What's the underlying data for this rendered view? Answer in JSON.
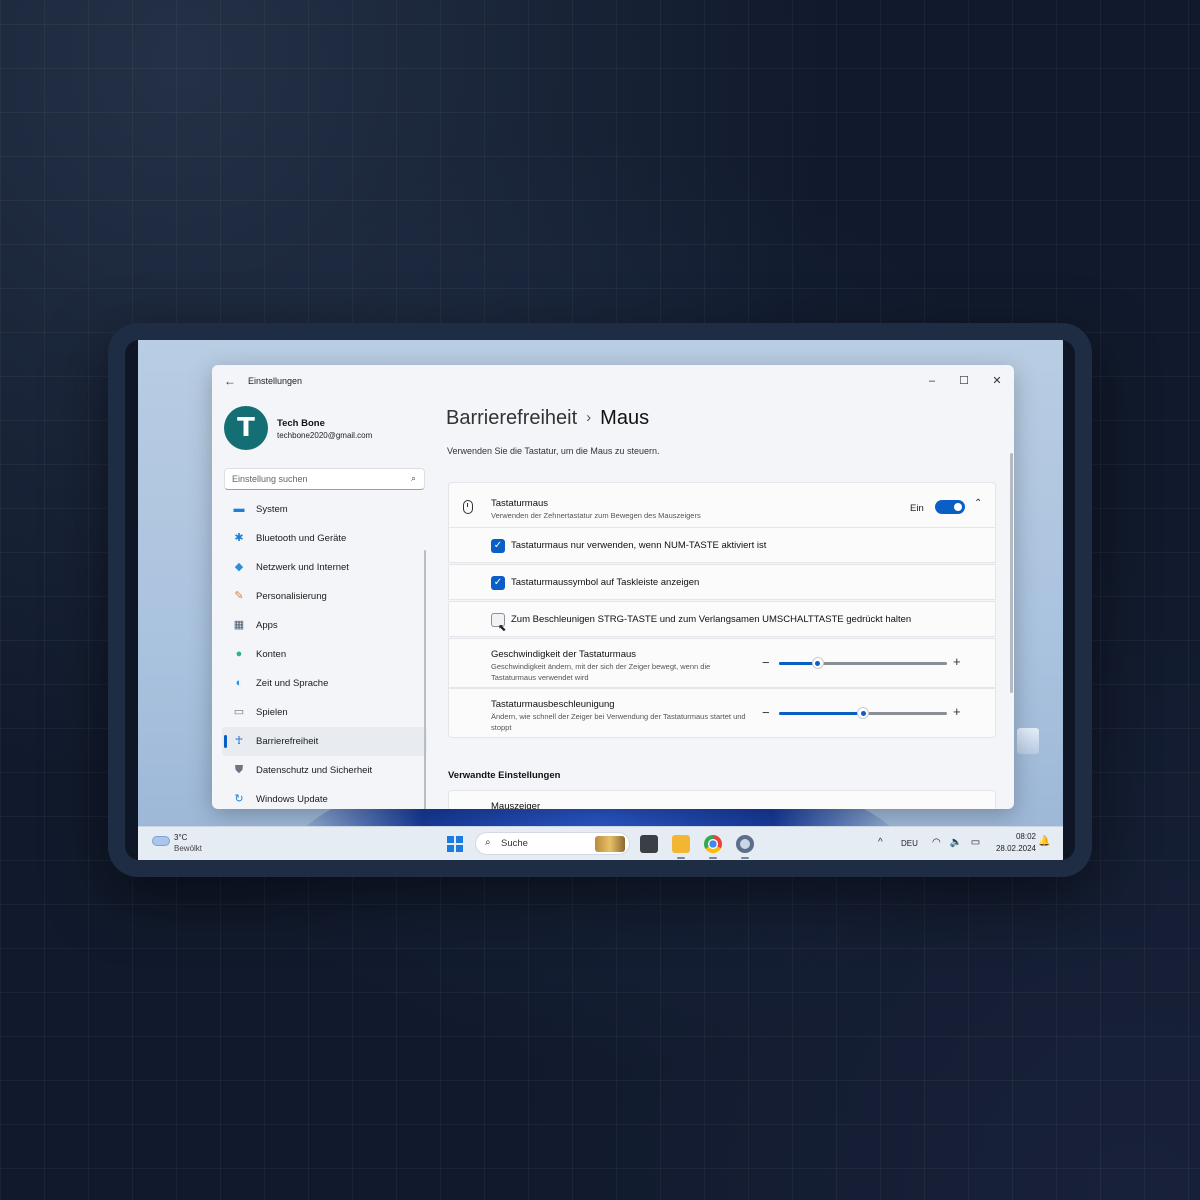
{
  "window": {
    "app_title": "Einstellungen",
    "minimize": "–",
    "maximize": "☐",
    "close": "✕",
    "back": "←"
  },
  "profile": {
    "avatar_letter": "T",
    "name": "Tech Bone",
    "email": "techbone2020@gmail.com"
  },
  "search": {
    "placeholder": "Einstellung suchen",
    "icon": "⌕"
  },
  "sidebar": {
    "items": [
      {
        "label": "System",
        "icon": "▬",
        "color": "#1e7fd6"
      },
      {
        "label": "Bluetooth und Geräte",
        "icon": "✱",
        "color": "#1e7fd6"
      },
      {
        "label": "Netzwerk und Internet",
        "icon": "◆",
        "color": "#2a8fe0"
      },
      {
        "label": "Personalisierung",
        "icon": "✎",
        "color": "#d9822b"
      },
      {
        "label": "Apps",
        "icon": "▦",
        "color": "#4a5a72"
      },
      {
        "label": "Konten",
        "icon": "●",
        "color": "#2fb37a"
      },
      {
        "label": "Zeit und Sprache",
        "icon": "◐",
        "color": "#2a8fe0"
      },
      {
        "label": "Spielen",
        "icon": "▭",
        "color": "#6b7585"
      },
      {
        "label": "Barrierefreiheit",
        "icon": "☥",
        "color": "#0a5fc6"
      },
      {
        "label": "Datenschutz und Sicherheit",
        "icon": "⛊",
        "color": "#6b7585"
      },
      {
        "label": "Windows Update",
        "icon": "↻",
        "color": "#1e7fd6"
      }
    ],
    "active_index": 8
  },
  "breadcrumb": {
    "parent": "Barrierefreiheit",
    "separator": "›",
    "current": "Maus"
  },
  "description": "Verwenden Sie die Tastatur, um die Maus zu steuern.",
  "mouse_keys": {
    "title": "Tastaturmaus",
    "subtitle": "Verwenden der Zehnertastatur zum Bewegen des Mauszeigers",
    "toggle_label": "Ein",
    "toggle_on": true,
    "chevron": "⌃"
  },
  "options": [
    {
      "label": "Tastaturmaus nur verwenden, wenn NUM-TASTE aktiviert ist",
      "checked": true
    },
    {
      "label": "Tastaturmaussymbol auf Taskleiste anzeigen",
      "checked": true
    },
    {
      "label": "Zum Beschleunigen STRG-TASTE und zum Verlangsamen UMSCHALTTASTE gedrückt halten",
      "checked": false
    }
  ],
  "sliders": [
    {
      "title": "Geschwindigkeit der Tastaturmaus",
      "desc": "Geschwindigkeit ändern, mit der sich der Zeiger bewegt, wenn die Tastaturmaus verwendet wird",
      "value": 0.23
    },
    {
      "title": "Tastaturmausbeschleunigung",
      "desc": "Ändern, wie schnell der Zeiger bei Verwendung der Tastaturmaus startet und stoppt",
      "value": 0.5
    }
  ],
  "slider_minus": "−",
  "slider_plus": "+",
  "related": {
    "heading": "Verwandte Einstellungen",
    "first_item": "Mauszeiger"
  },
  "taskbar": {
    "weather_temp": "3°C",
    "weather_desc": "Bewölkt",
    "search_label": "Suche",
    "language": "DEU",
    "time": "08:02",
    "date": "28.02.2024",
    "tray_chevron": "^",
    "tray_icons": "◠ 🔈 ▭",
    "bell": "🔔"
  },
  "colors": {
    "accent": "#0a5fc6",
    "window_bg": "#f3f5f9"
  }
}
